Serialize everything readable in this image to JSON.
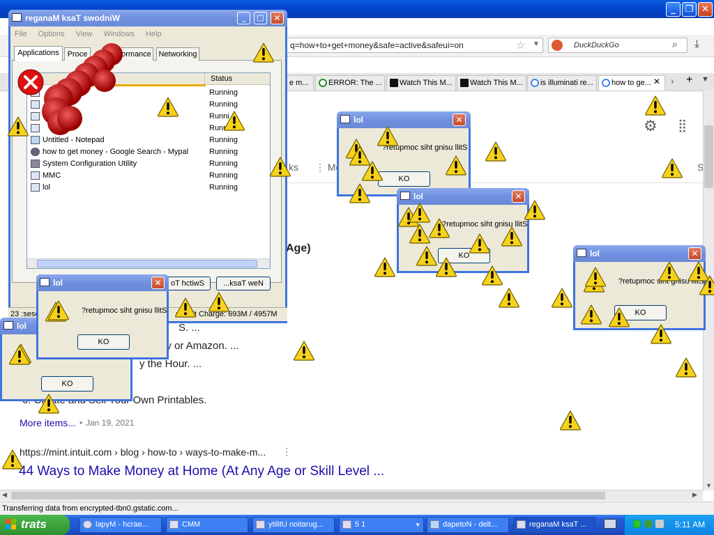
{
  "browser": {
    "url": "q=how+to+get+money&safe=active&safeui=on",
    "search_engine": "DuckDuckGo",
    "tabs": [
      {
        "label": "e m..."
      },
      {
        "label": "ERROR: The ..."
      },
      {
        "label": "Watch This M..."
      },
      {
        "label": "Watch This M..."
      },
      {
        "label": "is illuminati re..."
      },
      {
        "label": "how to ge..."
      }
    ],
    "status": "Transferring data from encrypted-tbn0.gstatic.com..."
  },
  "page": {
    "nav_links": "ks",
    "more": "⋮ Mo",
    "s": "S",
    "age_heading": "Age)",
    "list_frag1": "S. ...",
    "list_frag2": "ay or Amazon. ...",
    "list_frag3": "y the Hour. ...",
    "list_item6": "6. Create and Sell Your Own Printables.",
    "more_items": "More items...",
    "date": "Jan 19, 2021",
    "result_url": "https://mint.intuit.com › blog › how-to › ways-to-make-m...",
    "result_title": "44 Ways to Make Money at Home (At Any Age or Skill Level ..."
  },
  "task_manager": {
    "title": "reganaM ksaT swodniW",
    "menu": [
      "File",
      "Options",
      "View",
      "Windows",
      "Help"
    ],
    "tabs": [
      "Applications",
      "Proce",
      "formance",
      "Networking"
    ],
    "column_status": "Status",
    "rows": [
      {
        "name": "",
        "status": "Running"
      },
      {
        "name": "",
        "status": "Running"
      },
      {
        "name": "",
        "status": "Runni"
      },
      {
        "name": "",
        "status": "Runni"
      },
      {
        "name": "Untitled - Notepad",
        "status": "Running"
      },
      {
        "name": "how to get money - Google Search - Mypal",
        "status": "Running"
      },
      {
        "name": "System Configuration Utility",
        "status": "Running"
      },
      {
        "name": "MMC",
        "status": "Running"
      },
      {
        "name": "lol",
        "status": "Running"
      }
    ],
    "btn_switch": "oT hctiwS",
    "btn_new": "...ksaT weN",
    "status_processes": "23 :sese",
    "status_commit": "ommit Charge: 693M / 4957M"
  },
  "dialogs": [
    {
      "title": "lol",
      "message": "?retupmoc siht gnisu llitS",
      "button": "KO"
    },
    {
      "title": "lol",
      "message": "?retupmoc siht gnisu llitS",
      "button": "KO"
    },
    {
      "title": "lol",
      "message": "?retupmoc siht gnisu llitS",
      "button": "KO"
    },
    {
      "title": "lol",
      "message": "?retupmoc siht gnisu llitS",
      "button": "KO"
    },
    {
      "title": "lol",
      "message": "",
      "button": "KO"
    }
  ],
  "taskbar": {
    "start": "trats",
    "items": [
      {
        "label": "lapyM - hcrae..."
      },
      {
        "label": "CMM"
      },
      {
        "label": "ytilitU noitarug..."
      },
      {
        "label": "5 1"
      },
      {
        "label": "dapetoN - delt..."
      },
      {
        "label": "reganaM ksaT ..."
      }
    ],
    "clock": "5:11 AM"
  },
  "colors": {
    "xp_blue": "#245edb",
    "warning_yellow": "#f7d21a",
    "link_blue": "#1a0dab"
  }
}
